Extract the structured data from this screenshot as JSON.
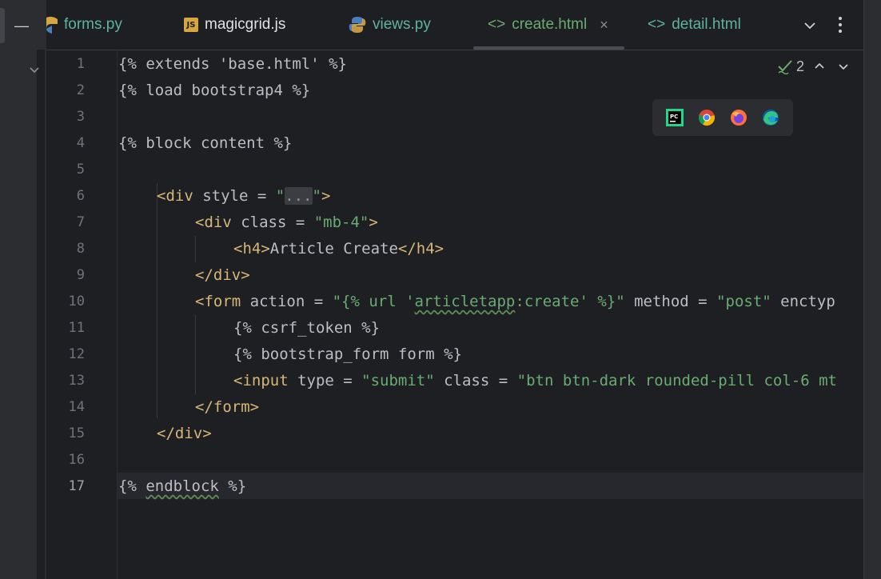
{
  "tabs": [
    {
      "label": "forms.py",
      "icon": "python-icon"
    },
    {
      "label": "magicgrid.js",
      "icon": "js-icon",
      "badge": "JS"
    },
    {
      "label": "views.py",
      "icon": "python-icon"
    },
    {
      "label": "create.html",
      "icon": "html-tag-icon",
      "prefix": "<>",
      "close": "×",
      "active": true
    },
    {
      "label": "detail.html",
      "icon": "html-tag-icon",
      "prefix": "<>"
    }
  ],
  "inspection": {
    "count": "2"
  },
  "browsers": [
    "pycharm-icon",
    "chrome-icon",
    "firefox-icon",
    "edge-icon"
  ],
  "browser_badge": "PC",
  "left_strip": {
    "dash": "—"
  },
  "current_line": 17,
  "line_numbers": [
    "1",
    "2",
    "3",
    "4",
    "5",
    "6",
    "7",
    "8",
    "9",
    "10",
    "11",
    "12",
    "13",
    "14",
    "15",
    "16",
    "17"
  ],
  "code": {
    "l1": "{% extends 'base.html' %}",
    "l2": "{% load bootstrap4 %}",
    "l4": "{% block content %}",
    "l6": {
      "open": "<div",
      "attr": " style = ",
      "q1": "\"",
      "fold": "...",
      "q2": "\"",
      "close": ">"
    },
    "l7": {
      "open": "<div",
      "attr": " class = ",
      "val": "\"mb-4\"",
      "close": ">"
    },
    "l8": {
      "open": "<h4>",
      "text": "Article Create",
      "close": "</h4>"
    },
    "l9": "</div>",
    "l10": {
      "open": "<form",
      "attr": " action = ",
      "val_a": "\"{% url '",
      "val_b": "articletapp",
      "val_c": ":create' %}\"",
      "attr2": " method = ",
      "val2": "\"post\"",
      "rest": " enctyp"
    },
    "l11": "{% csrf_token %}",
    "l12": "{% bootstrap_form form %}",
    "l13": {
      "open": "<input",
      "attr": " type = ",
      "val": "\"submit\"",
      "attr2": " class = ",
      "val2": "\"btn btn-dark rounded-pill col-6 mt"
    },
    "l14": "</form>",
    "l15": "</div>",
    "l17": {
      "a": "{% ",
      "b": "endblock",
      "c": " %}"
    }
  },
  "colors": {
    "tag": "#d5b778",
    "string": "#6aab73",
    "text": "#bcbec4",
    "background": "#1e1f22"
  }
}
